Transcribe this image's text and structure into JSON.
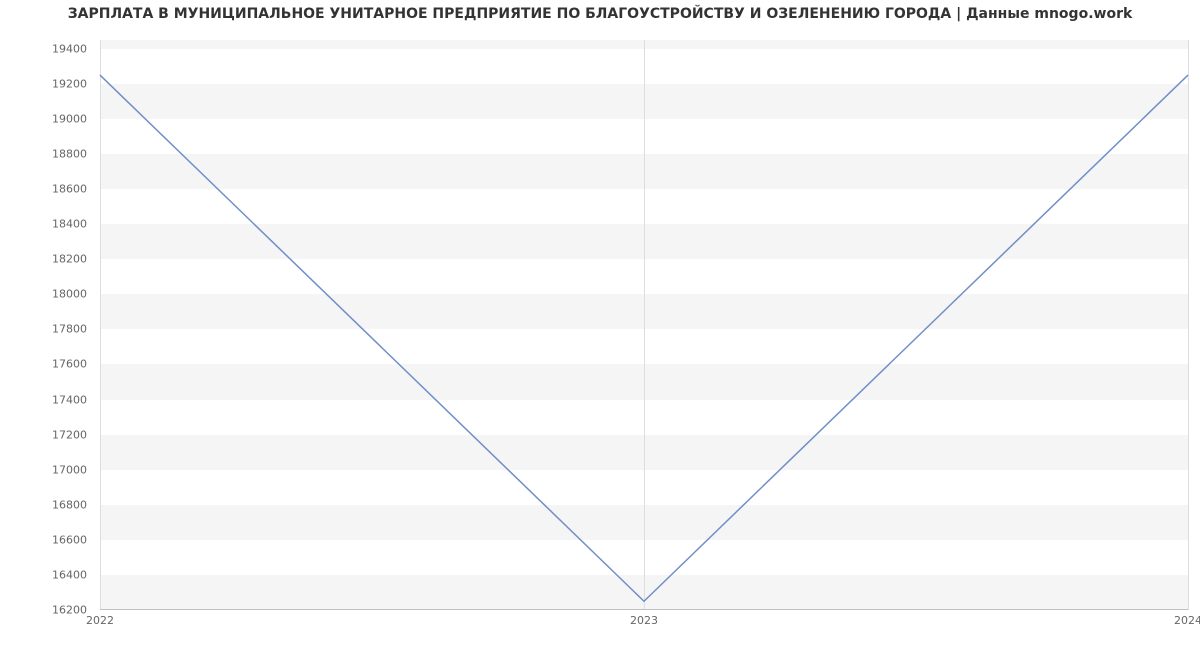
{
  "chart_data": {
    "type": "line",
    "title": "ЗАРПЛАТА В МУНИЦИПАЛЬНОЕ УНИТАРНОЕ ПРЕДПРИЯТИЕ ПО БЛАГОУСТРОЙСТВУ И ОЗЕЛЕНЕНИЮ ГОРОДА | Данные mnogo.work",
    "x": [
      2022,
      2023,
      2024
    ],
    "values": [
      19250,
      16250,
      19250
    ],
    "x_tick_labels": [
      "2022",
      "2023",
      "2024"
    ],
    "y_tick_labels": [
      "16200",
      "16400",
      "16600",
      "16800",
      "17000",
      "17200",
      "17400",
      "17600",
      "17800",
      "18000",
      "18200",
      "18400",
      "18600",
      "18800",
      "19000",
      "19200",
      "19400"
    ],
    "y_tick_values": [
      16200,
      16400,
      16600,
      16800,
      17000,
      17200,
      17400,
      17600,
      17800,
      18000,
      18200,
      18400,
      18600,
      18800,
      19000,
      19200,
      19400
    ],
    "ylim": [
      16200,
      19450
    ],
    "xlim": [
      2022,
      2024
    ],
    "line_color": "#6f8fc8",
    "band_color": "#f5f5f5",
    "grid": true
  }
}
